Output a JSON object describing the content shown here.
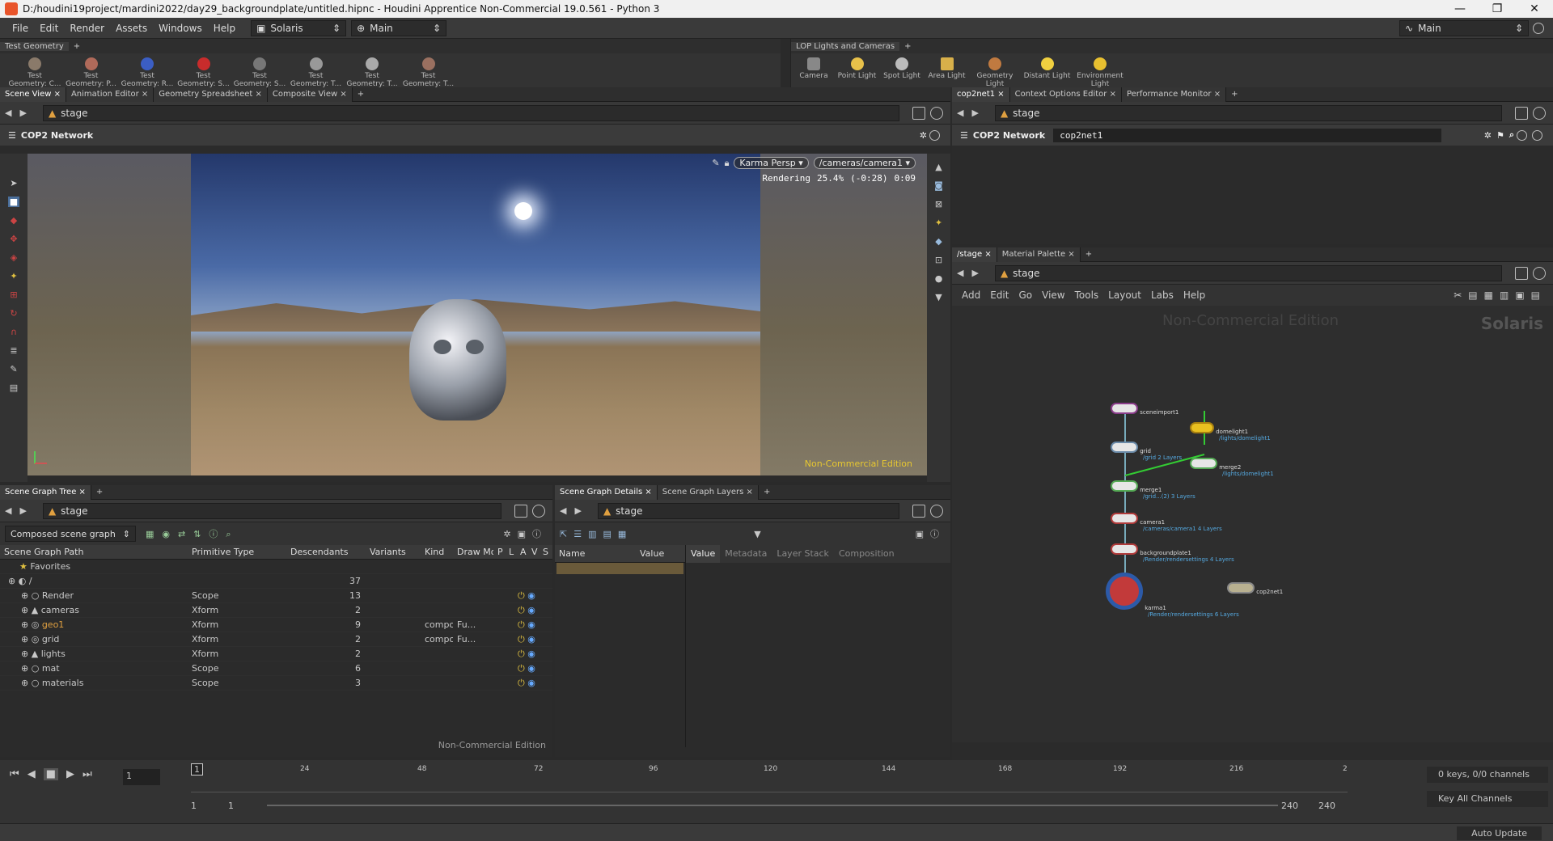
{
  "window": {
    "title": "D:/houdini19project/mardini2022/day29_backgroundplate/untitled.hipnc - Houdini Apprentice Non-Commercial 19.0.561 - Python 3",
    "controls": [
      "—",
      "❐",
      "✕"
    ]
  },
  "menu": {
    "items": [
      "File",
      "Edit",
      "Render",
      "Assets",
      "Windows",
      "Help"
    ],
    "desktop": "Solaris",
    "workspace": "Main",
    "right_workspace": "Main"
  },
  "shelf_left": {
    "tab": "Test Geometry",
    "tools": [
      "Test Geometry: C...",
      "Test Geometry: P...",
      "Test Geometry: R...",
      "Test Geometry: S...",
      "Test Geometry: S...",
      "Test Geometry: T...",
      "Test Geometry: T...",
      "Test Geometry: T..."
    ]
  },
  "shelf_right": {
    "tab": "LOP Lights and Cameras",
    "tools": [
      "Camera",
      "Point Light",
      "Spot Light",
      "Area Light",
      "Geometry Light",
      "Distant Light",
      "Environment Light"
    ]
  },
  "viewer": {
    "tabs": [
      "Scene View",
      "Animation Editor",
      "Geometry Spreadsheet",
      "Composite View"
    ],
    "path": "stage",
    "network_label": "COP2 Network",
    "renderer": "Karma Persp",
    "camera": "/cameras/camera1",
    "status": "Rendering",
    "progress": "25.4%",
    "eta": "(-0:28)",
    "elapsed": "0:09",
    "watermark": "Non-Commercial Edition"
  },
  "right_top": {
    "tabs": [
      "cop2net1",
      "Context Options Editor",
      "Performance Monitor"
    ],
    "path": "stage",
    "network_label": "COP2 Network",
    "node_name": "cop2net1"
  },
  "network": {
    "tabs": [
      "/stage",
      "Material Palette"
    ],
    "path": "stage",
    "menu": [
      "Add",
      "Edit",
      "Go",
      "View",
      "Tools",
      "Layout",
      "Labs",
      "Help"
    ],
    "watermark": "Non-Commercial Edition",
    "context": "Solaris",
    "nodes": [
      {
        "name": "sceneimport1",
        "sub": ""
      },
      {
        "name": "domelight1",
        "sub": "/lights/domelight1"
      },
      {
        "name": "grid",
        "sub": "/grid 2 Layers"
      },
      {
        "name": "merge2",
        "sub": "/lights/domelight1"
      },
      {
        "name": "merge1",
        "sub": "/grid...(2) 3 Layers"
      },
      {
        "name": "camera1",
        "sub": "/cameras/camera1 4 Layers"
      },
      {
        "name": "backgroundplate1",
        "sub": "/Render/rendersettings 4 Layers"
      },
      {
        "name": "karma1",
        "sub": "/Render/rendersettings 6 Layers"
      },
      {
        "name": "cop2net1",
        "sub": ""
      }
    ]
  },
  "scene_graph": {
    "tab": "Scene Graph Tree",
    "path": "stage",
    "mode": "Composed scene graph",
    "columns": [
      "Scene Graph Path",
      "Primitive Type",
      "Descendants",
      "Variants",
      "Kind",
      "Draw Mo",
      "P",
      "L",
      "A",
      "V",
      "S"
    ],
    "favorites": "Favorites",
    "rows": [
      {
        "name": "/",
        "type": "",
        "desc": "37",
        "kind": "",
        "draw": ""
      },
      {
        "name": "Render",
        "type": "Scope",
        "desc": "13",
        "kind": "",
        "draw": ""
      },
      {
        "name": "cameras",
        "type": "Xform",
        "desc": "2",
        "kind": "",
        "draw": ""
      },
      {
        "name": "geo1",
        "type": "Xform",
        "desc": "9",
        "kind": "compo",
        "draw": "Fu..."
      },
      {
        "name": "grid",
        "type": "Xform",
        "desc": "2",
        "kind": "compo",
        "draw": "Fu..."
      },
      {
        "name": "lights",
        "type": "Xform",
        "desc": "2",
        "kind": "",
        "draw": ""
      },
      {
        "name": "mat",
        "type": "Scope",
        "desc": "6",
        "kind": "",
        "draw": ""
      },
      {
        "name": "materials",
        "type": "Scope",
        "desc": "3",
        "kind": "",
        "draw": ""
      }
    ],
    "watermark": "Non-Commercial Edition"
  },
  "details": {
    "tabs": [
      "Scene Graph Details",
      "Scene Graph Layers"
    ],
    "path": "stage",
    "columns": [
      "Name",
      "Value"
    ],
    "value_tabs": [
      "Value",
      "Metadata",
      "Layer Stack",
      "Composition"
    ]
  },
  "timeline": {
    "frame": "1",
    "current_marker": "1",
    "ticks": [
      "24",
      "48",
      "72",
      "96",
      "120",
      "144",
      "168",
      "192",
      "216",
      "2"
    ],
    "start": "1",
    "start2": "1",
    "end": "240",
    "end2": "240",
    "keys": "0 keys, 0/0 channels",
    "key_all": "Key All Channels"
  },
  "status": {
    "auto_update": "Auto Update"
  }
}
